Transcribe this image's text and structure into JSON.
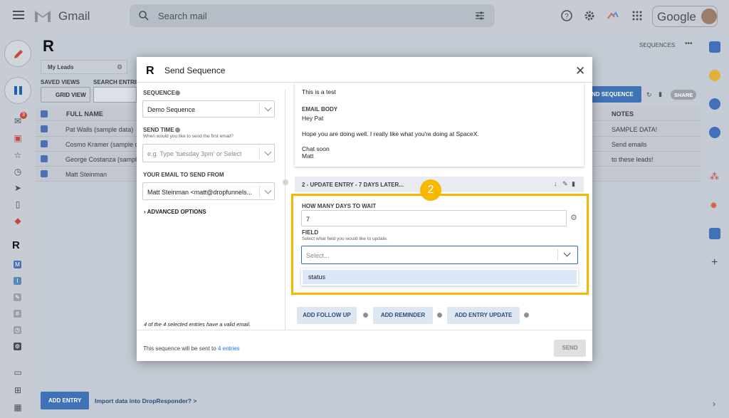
{
  "gmail": {
    "app_name": "Gmail",
    "search_placeholder": "Search mail",
    "brand": "Google",
    "compose_badge": "3"
  },
  "app": {
    "sequences_label": "SEQUENCES",
    "saved_views_label": "SAVED VIEWS",
    "search_entries_label": "SEARCH ENTRIES",
    "grid_view_label": "GRID VIEW",
    "tab_label": "My Leads",
    "send_sequence_label": "ND SEQUENCE",
    "share_label": "SHARE",
    "columns": [
      "FULL NAME",
      "NOTES"
    ],
    "rows": [
      {
        "name": "Pat Walls (sample data)",
        "note": "SAMPLE DATA!"
      },
      {
        "name": "Cosmo Kramer (sample da",
        "note": "Send emails"
      },
      {
        "name": "George Costanza (sample",
        "note": "to these leads!"
      },
      {
        "name": "Matt Steinman",
        "note": ""
      }
    ],
    "add_entry_label": "ADD ENTRY",
    "import_label": "Import data into DropResponder? >"
  },
  "modal": {
    "title": "Send Sequence",
    "sequence_label": "SEQUENCE",
    "sequence_value": "Demo Sequence",
    "send_time_label": "SEND TIME",
    "send_time_hint": "When would you like to send the first email?",
    "send_time_placeholder": "e.g. Type 'tuesday 3pm' or Select",
    "email_from_label": "YOUR EMAIL TO SEND FROM",
    "email_from_value": "Matt Steinman <matt@dropfunnels...",
    "advanced_options": "ADVANCED OPTIONS",
    "valid_email_note": "4 of the 4 selected entries have a valid email.",
    "email_subject": "This is a test",
    "email_body_label": "EMAIL BODY",
    "email_body_lines": [
      "Hey Pat",
      "Hope you are doing well. I really like what you're doing at SpaceX.",
      "Chat soon",
      "Matt"
    ],
    "step_header": "2 - UPDATE ENTRY - 7 DAYS LATER...",
    "days_label": "HOW MANY DAYS TO WAIT",
    "days_value": "7",
    "field_label": "FIELD",
    "field_hint": "Select what field you would like to update.",
    "field_placeholder": "Select...",
    "option_status": "status",
    "badge_number": "2",
    "add_follow_up": "ADD FOLLOW UP",
    "add_reminder": "ADD REMINDER",
    "add_entry_update": "ADD ENTRY UPDATE",
    "footer_text": "This sequence will be sent to",
    "footer_link": "4 entries",
    "send_label": "SEND"
  },
  "colors": {
    "accent": "#1a73e8",
    "highlight": "#f6b800",
    "button_blue": "#1f5fb0"
  }
}
